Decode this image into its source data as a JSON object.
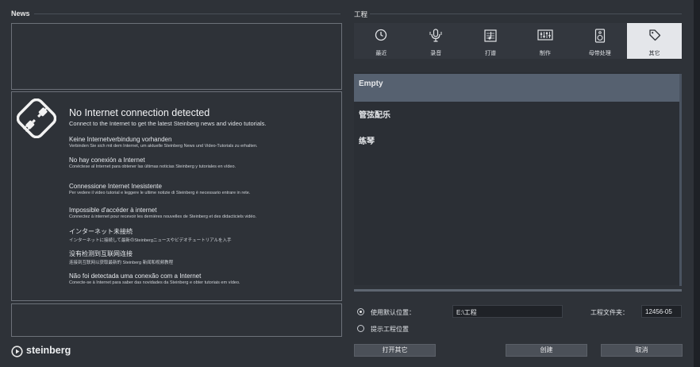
{
  "news": {
    "title": "News",
    "notice_heading": "No Internet connection detected",
    "notice_subheading": "Connect to the Internet to get the latest Steinberg news and video tutorials.",
    "languages": [
      {
        "title": "Keine Internetverbindung vorhanden",
        "desc": "Verbinden Sie sich mit dem Internet, um aktuelle Steinberg News und Video-Tutorials zu erhalten."
      },
      {
        "title": "No hay conexión a Internet",
        "desc": "Conéctese al Internet para obtener las últimas noticias Steinberg y tutoriales en vídeo."
      },
      {
        "title": "Connessione Internet Inesistente",
        "desc": "Per vedere il video tutorial e leggere le ultime notizie di Steinberg è necessario entrare in rete."
      },
      {
        "title": "Impossible d'accéder à internet",
        "desc": "Connectez à internet pour recevoir les dernières nouvelles de Steinberg et des didacticiels vidéo."
      },
      {
        "title": "インターネット未接続",
        "desc": "インターネットに接続して最新のSteinbergニュースやビデオチュートリアルを入手"
      },
      {
        "title": "没有检测到互联网连接",
        "desc": "连接到互联网以获取最新的 Steinberg 新闻和视频教程"
      },
      {
        "title": "Não foi detectada uma conexão com a Internet",
        "desc": "Conecte-se à Internet para saber das novidades da Steinberg e obter tutoriais em vídeo."
      }
    ]
  },
  "brand": {
    "name": "steinberg"
  },
  "project": {
    "title": "工程",
    "categories": [
      {
        "label": "最近",
        "icon": "clock-icon"
      },
      {
        "label": "录音",
        "icon": "microphone-icon"
      },
      {
        "label": "打谱",
        "icon": "score-icon"
      },
      {
        "label": "制作",
        "icon": "mixer-icon"
      },
      {
        "label": "母带处理",
        "icon": "speaker-icon"
      },
      {
        "label": "其它",
        "icon": "tag-icon",
        "active": true
      }
    ],
    "templates": [
      {
        "label": "Empty",
        "selected": true
      },
      {
        "label": "管弦配乐"
      },
      {
        "label": "练琴"
      }
    ]
  },
  "location": {
    "use_default_label": "使用默认位置：",
    "prompt_label": "提示工程位置",
    "path_value": "E:\\工程",
    "folder_label": "工程文件夹：",
    "folder_value": "12456-05",
    "use_default_selected": true
  },
  "buttons": {
    "open_other": "打开其它",
    "create": "创建",
    "cancel": "取消"
  },
  "colors": {
    "background": "#2e3238",
    "selected": "#566170",
    "active_tab": "#e4e6ea"
  }
}
